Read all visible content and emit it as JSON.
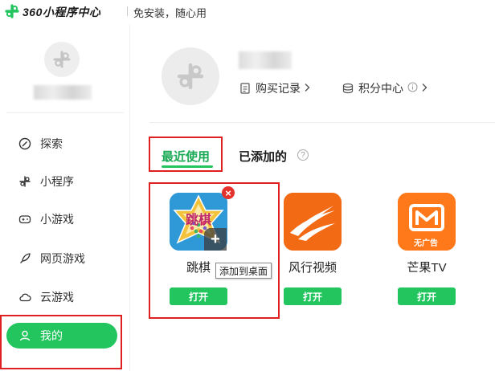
{
  "header": {
    "brand": "360小程序中心",
    "slogan": "免安装，随心用"
  },
  "sidebar": {
    "items": [
      {
        "label": "探索",
        "icon": "compass-icon"
      },
      {
        "label": "小程序",
        "icon": "miniprogram-icon"
      },
      {
        "label": "小游戏",
        "icon": "gamepad-icon"
      },
      {
        "label": "网页游戏",
        "icon": "rocket-icon"
      },
      {
        "label": "云游戏",
        "icon": "cloud-icon"
      },
      {
        "label": "我的",
        "icon": "user-icon",
        "active": true
      }
    ]
  },
  "profile": {
    "purchase_label": "购买记录",
    "points_label": "积分中心"
  },
  "tabs": {
    "recent": "最近使用",
    "added": "已添加的",
    "help": "?"
  },
  "apps": [
    {
      "name": "跳棋",
      "icon_text": "跳棋",
      "button": "打开"
    },
    {
      "name": "风行视频",
      "button": "打开"
    },
    {
      "name": "芒果TV",
      "icon_text": "无广告",
      "button": "打开"
    }
  ],
  "overlay": {
    "close": "×",
    "add_plus": "+",
    "tooltip": "添加到桌面"
  },
  "colors": {
    "accent": "#22c55e",
    "annotation": "#e02020"
  }
}
